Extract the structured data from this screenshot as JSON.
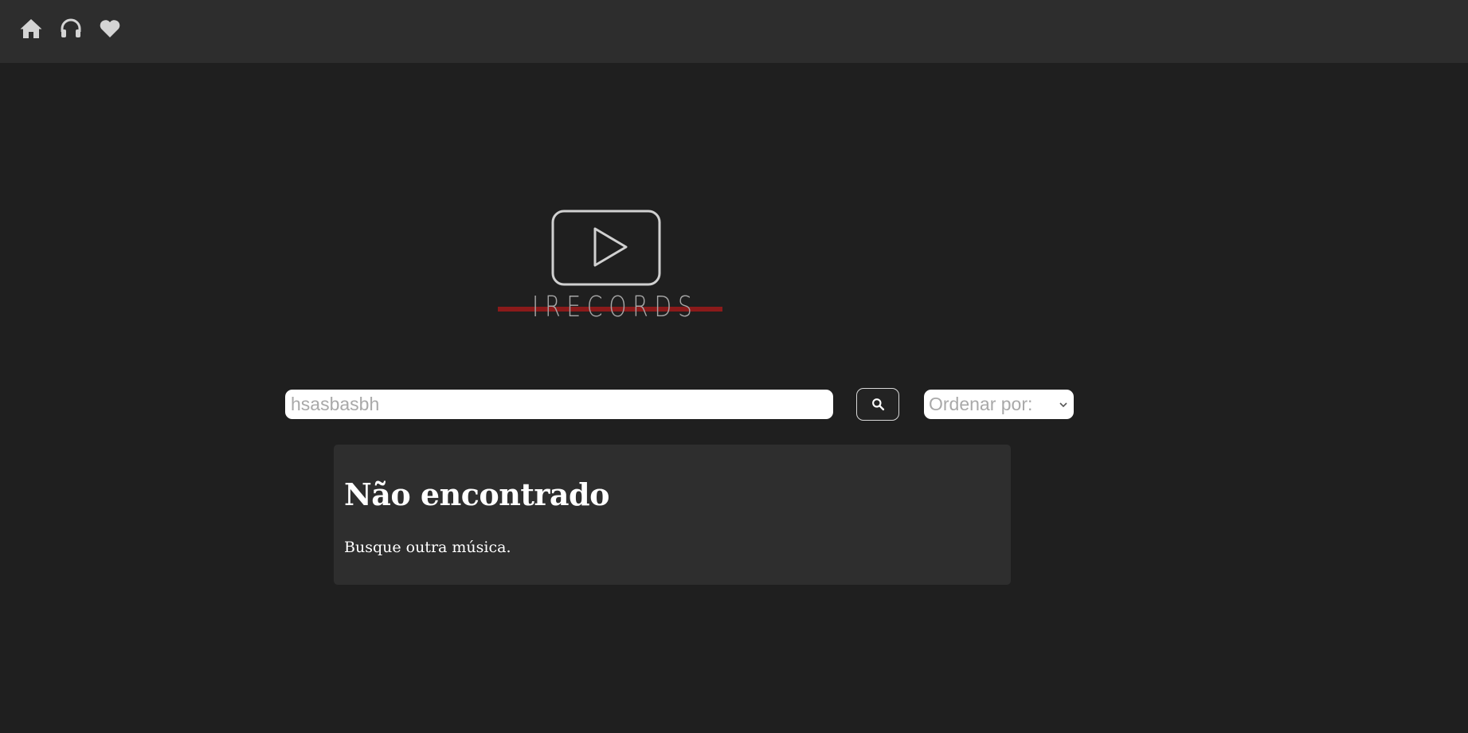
{
  "nav": {
    "items": [
      {
        "icon": "home-icon",
        "label": "Home"
      },
      {
        "icon": "headphones-icon",
        "label": "Músicas"
      },
      {
        "icon": "heart-icon",
        "label": "Favoritas"
      }
    ]
  },
  "logo": {
    "text": "IRECORDS",
    "accent_color": "#8b1a1a",
    "icon": "play-icon"
  },
  "search": {
    "value": "",
    "placeholder": "hsasbasbh",
    "button_icon": "search-icon"
  },
  "sort": {
    "selected": "Ordenar por:"
  },
  "result": {
    "title": "Não encontrado",
    "message": "Busque outra música."
  },
  "colors": {
    "background": "#1f1f1f",
    "topbar": "#2d2d2d",
    "card": "#2e2e2e",
    "icon": "#d4d4d4"
  }
}
